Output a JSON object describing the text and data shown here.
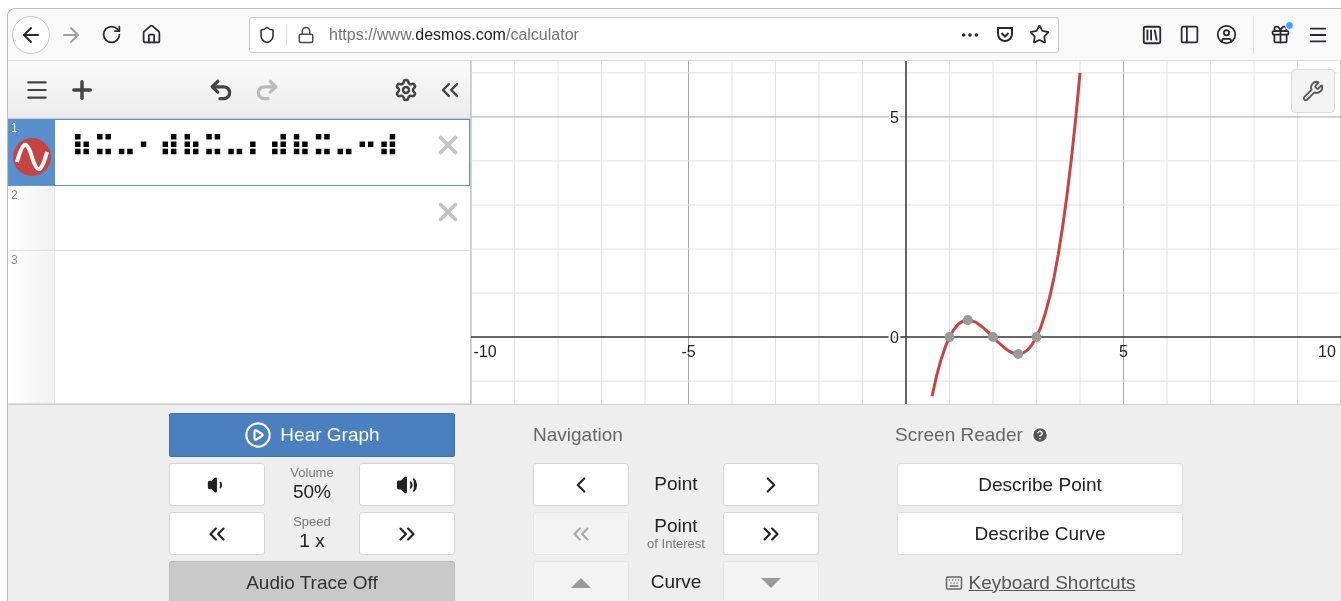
{
  "browser": {
    "url": {
      "scheme": "https://www.",
      "domain": "desmos.com",
      "path": "/calculator"
    },
    "forward_disabled": true,
    "notification": true
  },
  "expression_toolbar": {
    "undo_disabled": false,
    "redo_disabled": true
  },
  "expressions": [
    {
      "number": "1",
      "text": "⠷⠭⠤⠂⠾⠷⠭⠤⠆⠾⠷⠭⠤⠒⠾",
      "selected": true,
      "color": "#c74440",
      "deletable": true
    },
    {
      "number": "2",
      "selected": false,
      "deletable": true
    },
    {
      "number": "3",
      "selected": false,
      "deletable": false
    }
  ],
  "graph": {
    "chart_data": {
      "type": "line",
      "xlim": [
        -10,
        10
      ],
      "ylim": [
        -1.52,
        6.27
      ],
      "grid": true,
      "xticks": [
        {
          "value": -10,
          "label": "-10"
        },
        {
          "value": -5,
          "label": "-5"
        },
        {
          "value": 5,
          "label": "5"
        },
        {
          "value": 10,
          "label": "10"
        }
      ],
      "yticks": [
        {
          "value": 0,
          "label": "0"
        },
        {
          "value": 5,
          "label": "5"
        }
      ],
      "x": [
        0.6,
        0.7,
        0.8,
        0.9,
        1.0,
        1.1,
        1.2,
        1.3,
        1.42,
        1.5,
        1.6,
        1.7,
        1.8,
        1.9,
        2.0,
        2.1,
        2.2,
        2.3,
        2.4,
        2.5,
        2.58,
        2.7,
        2.8,
        2.9,
        3.0,
        3.1,
        3.2,
        3.3,
        3.4,
        3.5,
        3.6,
        3.7,
        3.8,
        3.9,
        4.0
      ],
      "series": [
        {
          "color": "#c74440",
          "values": [
            -1.34,
            -0.9,
            -0.53,
            -0.23,
            0,
            0.17,
            0.29,
            0.36,
            0.385,
            0.375,
            0.34,
            0.27,
            0.19,
            0.1,
            0,
            -0.1,
            -0.19,
            -0.27,
            -0.34,
            -0.375,
            -0.385,
            -0.36,
            -0.29,
            -0.17,
            0,
            0.23,
            0.53,
            0.9,
            1.34,
            1.88,
            2.5,
            3.21,
            4.03,
            4.96,
            6
          ]
        }
      ]
    }
  },
  "audio": {
    "hear_graph": "Hear Graph",
    "volume": {
      "label": "Volume",
      "value": "50%"
    },
    "speed": {
      "label": "Speed",
      "value": "1 x"
    },
    "trace": "Audio Trace Off"
  },
  "navigation": {
    "title": "Navigation",
    "rows": [
      {
        "kind": "chevron",
        "label": "Point",
        "prev_disabled": false,
        "next_disabled": false
      },
      {
        "kind": "double",
        "label": "Point",
        "sublabel": "of Interest",
        "prev_disabled": true,
        "next_disabled": false
      },
      {
        "kind": "triangle",
        "label": "Curve",
        "prev_disabled": true,
        "next_disabled": true
      }
    ]
  },
  "screen_reader": {
    "title": "Screen Reader",
    "buttons": [
      "Describe Point",
      "Describe Curve"
    ],
    "shortcuts_link": "Keyboard Shortcuts"
  }
}
